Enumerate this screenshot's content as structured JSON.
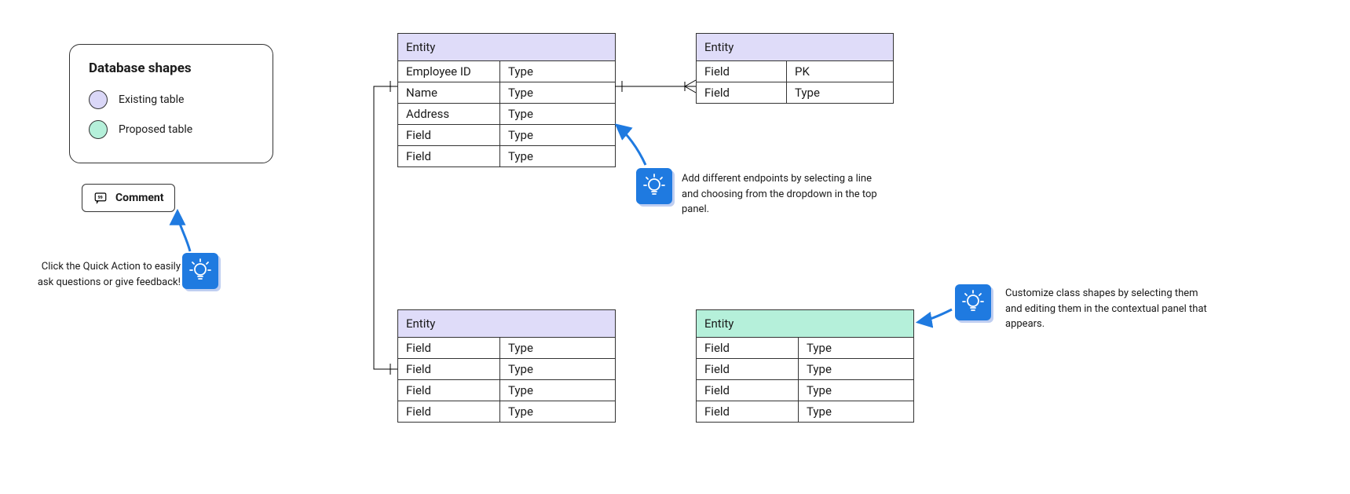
{
  "legend": {
    "title": "Database shapes",
    "items": [
      {
        "color": "purple",
        "label": "Existing table"
      },
      {
        "color": "teal",
        "label": "Proposed table"
      }
    ]
  },
  "comment_button": {
    "label": "Comment"
  },
  "tips": {
    "a": {
      "text": "Click the Quick Action to easily ask questions or give feedback!"
    },
    "b": {
      "text": "Add different endpoints by selecting a line and choosing from the dropdown in the top panel."
    },
    "c": {
      "text": "Customize class shapes by selecting them and editing them in the contextual panel that appears."
    }
  },
  "entities": {
    "e1": {
      "title": "Entity",
      "color": "purple",
      "rows": [
        {
          "field": "Employee ID",
          "type": "Type"
        },
        {
          "field": "Name",
          "type": "Type"
        },
        {
          "field": "Address",
          "type": "Type"
        },
        {
          "field": "Field",
          "type": "Type"
        },
        {
          "field": "Field",
          "type": "Type"
        }
      ]
    },
    "e2": {
      "title": "Entity",
      "color": "purple",
      "rows": [
        {
          "field": "Field",
          "type": "PK"
        },
        {
          "field": "Field",
          "type": "Type"
        }
      ]
    },
    "e3": {
      "title": "Entity",
      "color": "purple",
      "rows": [
        {
          "field": "Field",
          "type": "Type"
        },
        {
          "field": "Field",
          "type": "Type"
        },
        {
          "field": "Field",
          "type": "Type"
        },
        {
          "field": "Field",
          "type": "Type"
        }
      ]
    },
    "e4": {
      "title": "Entity",
      "color": "teal",
      "rows": [
        {
          "field": "Field",
          "type": "Type"
        },
        {
          "field": "Field",
          "type": "Type"
        },
        {
          "field": "Field",
          "type": "Type"
        },
        {
          "field": "Field",
          "type": "Type"
        }
      ]
    }
  }
}
